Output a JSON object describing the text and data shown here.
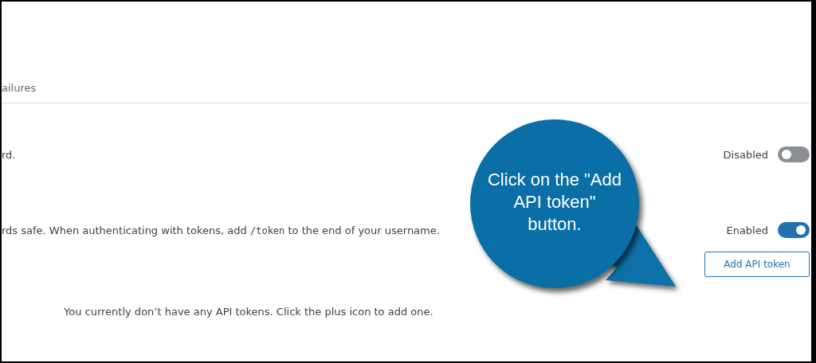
{
  "tab": {
    "label": "ailures"
  },
  "settings": [
    {
      "description": "rd.",
      "status": "Disabled",
      "on": false
    },
    {
      "description": "rds safe. When authenticating with tokens, add ",
      "code": "/token",
      "description_after": " to the end of your username.",
      "status": "Enabled",
      "on": true
    }
  ],
  "add_button": {
    "label": "Add API token"
  },
  "empty_message": "You currently don’t have any API tokens. Click the plus icon to add one.",
  "callout": {
    "text": "Click on the \"Add API token\" button."
  }
}
